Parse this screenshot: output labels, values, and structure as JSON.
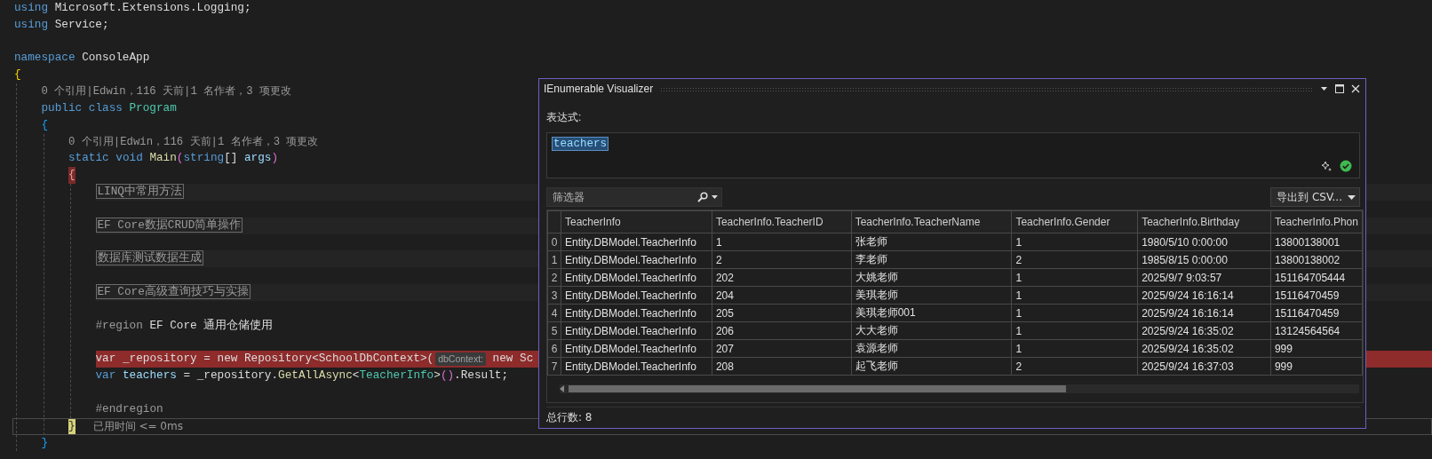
{
  "editor": {
    "lines": [
      {
        "kind": "code",
        "tokens": [
          {
            "t": "using",
            "kind": "kw"
          },
          {
            "t": " Microsoft.Extensions.Logging;",
            "kind": "text"
          }
        ]
      },
      {
        "kind": "code",
        "tokens": [
          {
            "t": "using",
            "kind": "kw"
          },
          {
            "t": " Service;",
            "kind": "text"
          }
        ]
      },
      {
        "kind": "blank"
      },
      {
        "kind": "code",
        "tokens": [
          {
            "t": "namespace",
            "kind": "kw"
          },
          {
            "t": " ConsoleApp",
            "kind": "text"
          }
        ]
      },
      {
        "kind": "code",
        "tokens": [
          {
            "t": "{",
            "kind": "brace-gold"
          }
        ],
        "children": [
          {
            "kind": "lens",
            "text": "0 个引用|Edwin，116 天前|1 名作者，3 项更改"
          },
          {
            "kind": "code",
            "tokens": [
              {
                "t": "public class",
                "kind": "kw"
              },
              {
                "t": " Program",
                "kind": "type"
              }
            ]
          },
          {
            "kind": "code",
            "tokens": [
              {
                "t": "{",
                "kind": "brace-blue"
              }
            ],
            "children": [
              {
                "kind": "lens",
                "text": "0 个引用|Edwin，116 天前|1 名作者，3 项更改"
              },
              {
                "kind": "code",
                "tokens": [
                  {
                    "t": "static void",
                    "kind": "kw"
                  },
                  {
                    "t": " Main",
                    "kind": "fn"
                  },
                  {
                    "t": "(",
                    "kind": "paren"
                  },
                  {
                    "t": "string",
                    "kind": "kw"
                  },
                  {
                    "t": "[] ",
                    "kind": "text"
                  },
                  {
                    "t": "args",
                    "kind": "var"
                  },
                  {
                    "t": ")",
                    "kind": "paren"
                  }
                ]
              },
              {
                "kind": "code",
                "tokens": [
                  {
                    "t": "{",
                    "kind": "brace-red"
                  }
                ],
                "children": [
                  {
                    "kind": "collapsed",
                    "text": "LINQ中常用方法"
                  },
                  {
                    "kind": "blank"
                  },
                  {
                    "kind": "collapsed",
                    "text": "EF Core数据CRUD简单操作"
                  },
                  {
                    "kind": "blank"
                  },
                  {
                    "kind": "collapsed",
                    "text": "数据库测试数据生成"
                  },
                  {
                    "kind": "blank"
                  },
                  {
                    "kind": "collapsed",
                    "text": "EF Core高级查询技巧与实操"
                  },
                  {
                    "kind": "blank"
                  },
                  {
                    "kind": "code",
                    "tokens": [
                      {
                        "t": "#region",
                        "kind": "pre"
                      },
                      {
                        "t": " EF Core 通用仓储使用",
                        "kind": "text"
                      }
                    ]
                  },
                  {
                    "kind": "blank"
                  },
                  {
                    "kind": "breakpoint",
                    "tokens": [
                      {
                        "t": "var _repository = new Repository<SchoolDbContext>(",
                        "kind": "text"
                      },
                      {
                        "t": "dbContext:",
                        "kind": "hint"
                      },
                      {
                        "t": " new Sc",
                        "kind": "text"
                      }
                    ]
                  },
                  {
                    "kind": "code",
                    "tokens": [
                      {
                        "t": "var",
                        "kind": "kw"
                      },
                      {
                        "t": " teachers",
                        "kind": "var"
                      },
                      {
                        "t": " = _repository.",
                        "kind": "text"
                      },
                      {
                        "t": "GetAllAsync",
                        "kind": "fn"
                      },
                      {
                        "t": "<",
                        "kind": "text"
                      },
                      {
                        "t": "TeacherInfo",
                        "kind": "type"
                      },
                      {
                        "t": ">",
                        "kind": "text"
                      },
                      {
                        "t": "()",
                        "kind": "paren"
                      },
                      {
                        "t": ".Result;",
                        "kind": "text"
                      }
                    ]
                  },
                  {
                    "kind": "blank"
                  },
                  {
                    "kind": "code",
                    "tokens": [
                      {
                        "t": "#endregion",
                        "kind": "pre"
                      }
                    ]
                  }
                ]
              },
              {
                "kind": "current",
                "tokens": [
                  {
                    "t": "}",
                    "kind": "brace-yellow"
                  },
                  {
                    "t": "已用时间 <= 0ms",
                    "kind": "perf"
                  }
                ]
              }
            ]
          },
          {
            "kind": "code",
            "tokens": [
              {
                "t": "}",
                "kind": "brace-blue"
              }
            ]
          }
        ]
      }
    ]
  },
  "visualizer": {
    "title": "IEnumerable Visualizer",
    "expression_label": "表达式:",
    "expression": {
      "value": "teachers",
      "text_selected": true
    },
    "filter": {
      "placeholder": "筛选器"
    },
    "export_button": "导出到 CSV...",
    "table": {
      "columns": [
        "TeacherInfo",
        "TeacherInfo.TeacherID",
        "TeacherInfo.TeacherName",
        "TeacherInfo.Gender",
        "TeacherInfo.Birthday",
        "TeacherInfo.Phon"
      ],
      "rows": [
        {
          "index": "0",
          "cells": [
            "Entity.DBModel.TeacherInfo",
            "1",
            "张老师",
            "1",
            "1980/5/10 0:00:00",
            "13800138001"
          ]
        },
        {
          "index": "1",
          "cells": [
            "Entity.DBModel.TeacherInfo",
            "2",
            "李老师",
            "2",
            "1985/8/15 0:00:00",
            "13800138002"
          ]
        },
        {
          "index": "2",
          "cells": [
            "Entity.DBModel.TeacherInfo",
            "202",
            "大姚老师",
            "1",
            "2025/9/7 9:03:57",
            "151164705444"
          ]
        },
        {
          "index": "3",
          "cells": [
            "Entity.DBModel.TeacherInfo",
            "204",
            "美琪老师",
            "1",
            "2025/9/24 16:16:14",
            "15116470459"
          ]
        },
        {
          "index": "4",
          "cells": [
            "Entity.DBModel.TeacherInfo",
            "205",
            "美琪老师001",
            "1",
            "2025/9/24 16:16:14",
            "15116470459"
          ]
        },
        {
          "index": "5",
          "cells": [
            "Entity.DBModel.TeacherInfo",
            "206",
            "大大老师",
            "1",
            "2025/9/24 16:35:02",
            "13124564564"
          ]
        },
        {
          "index": "6",
          "cells": [
            "Entity.DBModel.TeacherInfo",
            "207",
            "袁源老师",
            "1",
            "2025/9/24 16:35:02",
            "999"
          ]
        },
        {
          "index": "7",
          "cells": [
            "Entity.DBModel.TeacherInfo",
            "208",
            "起飞老师",
            "2",
            "2025/9/24 16:37:03",
            "999"
          ]
        }
      ]
    },
    "row_count": "总行数: 8"
  }
}
